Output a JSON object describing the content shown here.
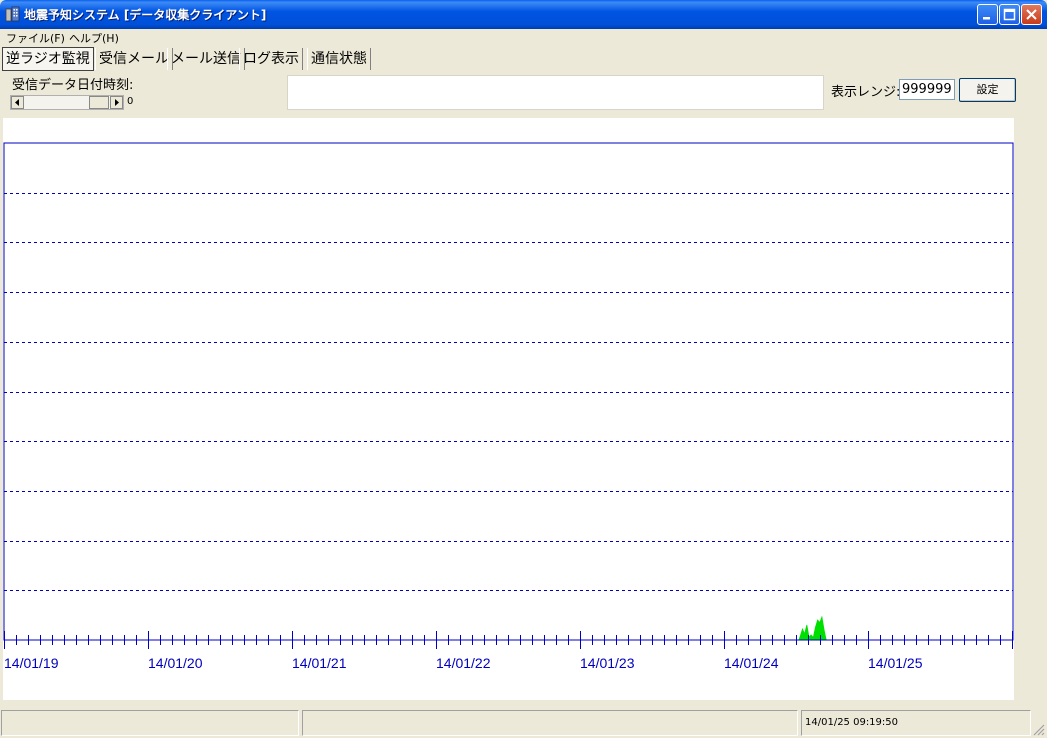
{
  "window": {
    "title": "地震予知システム [データ収集クライアント]"
  },
  "menu": {
    "items": [
      "ファイル(F)",
      "ヘルプ(H)"
    ]
  },
  "tabs": [
    "逆ラジオ監視",
    "受信メール",
    "メール送信",
    "ログ表示",
    "通信状態"
  ],
  "controls": {
    "recv_label": "受信データ日付時刻:",
    "scroll_value": "0",
    "range_label": "表示レンジ:",
    "range_value": "999999",
    "set_button": "設定"
  },
  "chart_data": {
    "type": "area",
    "x_tick_labels": [
      "14/01/19",
      "14/01/20",
      "14/01/21",
      "14/01/22",
      "14/01/23",
      "14/01/24",
      "14/01/25"
    ],
    "minor_ticks_per_day": 12,
    "horizontal_gridlines": 9,
    "grid": true,
    "series_color": "#00E000",
    "axis_color": "#0000C0",
    "series": [
      {
        "x": [
          5.52,
          5.53,
          5.545,
          5.56,
          5.575,
          5.59,
          5.605,
          5.62,
          5.635,
          5.65,
          5.665,
          5.68,
          5.695,
          5.71
        ],
        "y": [
          0,
          0.08,
          0.22,
          0.12,
          0.3,
          0.06,
          0.1,
          0.05,
          0.25,
          0.4,
          0.35,
          0.46,
          0.2,
          0
        ]
      }
    ]
  },
  "statusbar": {
    "panes": [
      "",
      "",
      "14/01/25 09:19:50"
    ]
  }
}
